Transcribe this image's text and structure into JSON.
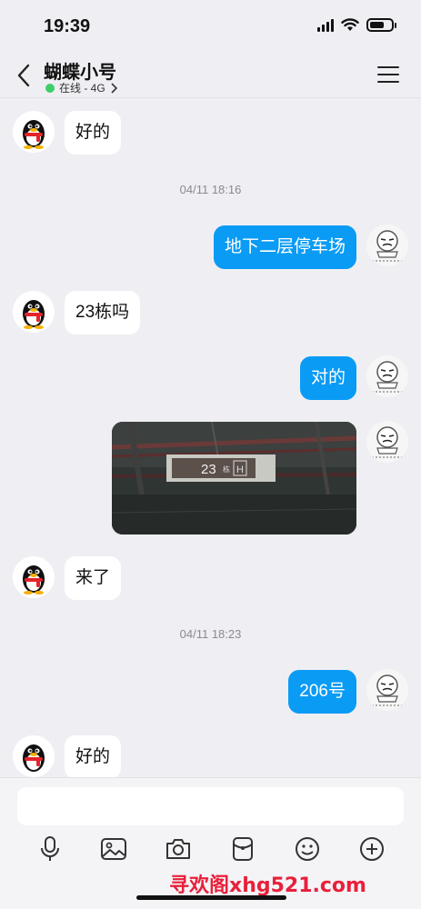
{
  "status_bar": {
    "time": "19:39"
  },
  "header": {
    "title": "蝴蝶小号",
    "presence": "在线 - 4G",
    "presence_color": "#3ecf6a"
  },
  "messages": [
    {
      "side": "in",
      "text": "好的"
    },
    {
      "type": "time",
      "text": "04/11 18:16"
    },
    {
      "side": "out",
      "text": "地下二层停车场"
    },
    {
      "side": "in",
      "text": "23栋吗"
    },
    {
      "side": "out",
      "text": "对的"
    },
    {
      "side": "out",
      "type": "image",
      "sign_text": "23",
      "sign_sub": "栋",
      "sign_letter": "H"
    },
    {
      "side": "in",
      "text": "来了"
    },
    {
      "type": "time",
      "text": "04/11 18:23"
    },
    {
      "side": "out",
      "text": "206号"
    },
    {
      "side": "in",
      "text": "好的"
    }
  ],
  "input": {
    "placeholder": ""
  },
  "toolbar": [
    "microphone-icon",
    "image-icon",
    "camera-icon",
    "red-packet-icon",
    "emoji-icon",
    "plus-icon"
  ],
  "watermark": "寻欢阁xhg521.com",
  "colors": {
    "accent": "#0a9bf5",
    "background": "#efeff3",
    "watermark": "#e8203b"
  }
}
